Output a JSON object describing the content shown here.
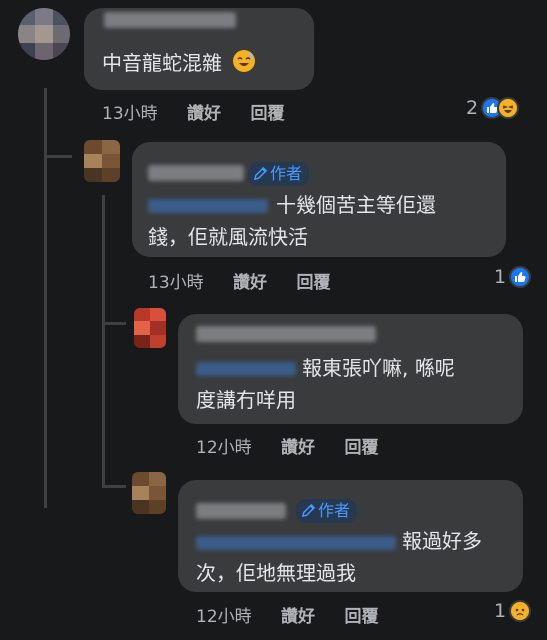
{
  "comments": [
    {
      "text_lines": [
        "中音龍蛇混雜"
      ],
      "emoji": "sweat-smile-emoji",
      "time": "13小時",
      "like_label": "讚好",
      "reply_label": "回覆",
      "reaction_count": "2",
      "reactions": [
        "like-icon",
        "haha-icon"
      ]
    },
    {
      "author_badge": "作者",
      "text_lines": [
        "十幾個苦主等佢還",
        "錢，佢就風流快活"
      ],
      "time": "13小時",
      "like_label": "讚好",
      "reply_label": "回覆",
      "reaction_count": "1",
      "reactions": [
        "like-icon"
      ]
    },
    {
      "text_lines": [
        "報東張吖嘛, 喺呢",
        "度講冇咩用"
      ],
      "time": "12小時",
      "like_label": "讚好",
      "reply_label": "回覆"
    },
    {
      "author_badge": "作者",
      "text_lines": [
        "報過好多",
        "次，佢地無理過我"
      ],
      "time": "12小時",
      "like_label": "讚好",
      "reply_label": "回覆",
      "reaction_count": "1",
      "reactions": [
        "sad-icon"
      ]
    }
  ],
  "colors": {
    "background": "#18191a",
    "bubble": "#3a3b3c",
    "meta_text": "#b0b3b8",
    "author_badge_text": "#4599ff",
    "like_blue": "#1877f2",
    "emoji_yellow": "#f7b125"
  }
}
